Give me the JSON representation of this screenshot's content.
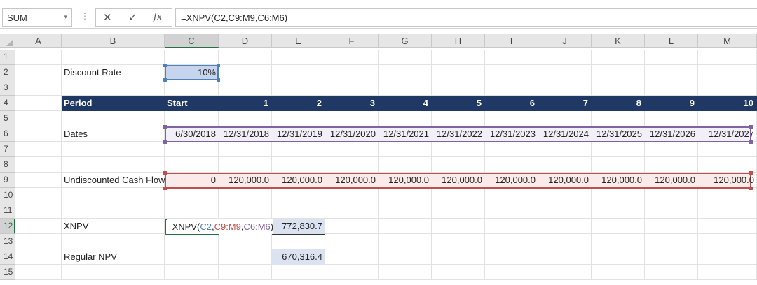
{
  "namebox": {
    "value": "SUM",
    "dropdown": "▾"
  },
  "formula_bar": {
    "dots": "⋮",
    "cancel": "✕",
    "enter": "✓",
    "fx": "fx",
    "formula": "=XNPV(C2,C9:M9,C6:M6)"
  },
  "columns": [
    "A",
    "B",
    "C",
    "D",
    "E",
    "F",
    "G",
    "H",
    "I",
    "J",
    "K",
    "L",
    "M"
  ],
  "rows": [
    "1",
    "2",
    "3",
    "4",
    "5",
    "6",
    "7",
    "8",
    "9",
    "10",
    "11",
    "12",
    "13",
    "14",
    "15"
  ],
  "selected_column": "C",
  "selected_row": "12",
  "sheet": {
    "discount_label": "Discount Rate",
    "discount_value": "10%",
    "period_label": "Period",
    "period_start": "Start",
    "periods": [
      "1",
      "2",
      "3",
      "4",
      "5",
      "6",
      "7",
      "8",
      "9",
      "10"
    ],
    "dates_label": "Dates",
    "dates": [
      "6/30/2018",
      "12/31/2018",
      "12/31/2019",
      "12/31/2020",
      "12/31/2021",
      "12/31/2022",
      "12/31/2023",
      "12/31/2024",
      "12/31/2025",
      "12/31/2026",
      "12/31/2027"
    ],
    "cf_label": "Undiscounted Cash Flow",
    "cash_flows": [
      "0",
      "120,000.0",
      "120,000.0",
      "120,000.0",
      "120,000.0",
      "120,000.0",
      "120,000.0",
      "120,000.0",
      "120,000.0",
      "120,000.0",
      "120,000.0"
    ],
    "xnpv_label": "XNPV",
    "xnpv_formula_parts": {
      "prefix": "=XNPV(",
      "arg1": "C2",
      "sep1": ",",
      "arg2": "C9:M9",
      "sep2": ",",
      "arg3": "C6:M6",
      "suffix": ")"
    },
    "xnpv_value": "772,830.7",
    "npv_label": "Regular NPV",
    "npv_value": "670,316.4"
  },
  "colors": {
    "header_band": "#1f3864",
    "selection_green": "#217346",
    "ref_blue": "#4f81bd",
    "ref_red": "#c0504d",
    "ref_purple": "#8064a2"
  }
}
